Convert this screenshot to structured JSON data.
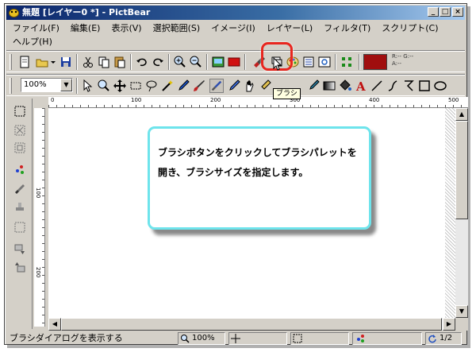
{
  "window": {
    "title": "無題 [レイヤー0 *] - PictBear",
    "controls": [
      "_",
      "□",
      "×"
    ]
  },
  "menu": [
    "ファイル(F)",
    "編集(E)",
    "表示(V)",
    "選択範囲(S)",
    "イメージ(I)",
    "レイヤー(L)",
    "フィルタ(T)",
    "スクリプト(C)",
    "ヘルプ(H)"
  ],
  "toolbar": {
    "zoom_value": "100%",
    "color_preview_text": "R:-- G:--\nA:--",
    "fg_color": "#a00e0e"
  },
  "tooltip": "ブラシ",
  "rulers": {
    "h_labels": [
      "0",
      "100",
      "200",
      "300",
      "400",
      "500"
    ],
    "v_labels": [
      "100",
      "200"
    ]
  },
  "callout": {
    "line1": "ブラシボタンをクリックしてブラシパレットを",
    "line2": "開き、ブラシサイズを指定します。"
  },
  "status": {
    "message": "ブラシダイアログを表示する",
    "zoom": "100%",
    "page": "1/2"
  },
  "colors": {
    "highlight": "#e8261f",
    "callout_border": "#6ee4ec",
    "title_bar": "#0a246a"
  }
}
